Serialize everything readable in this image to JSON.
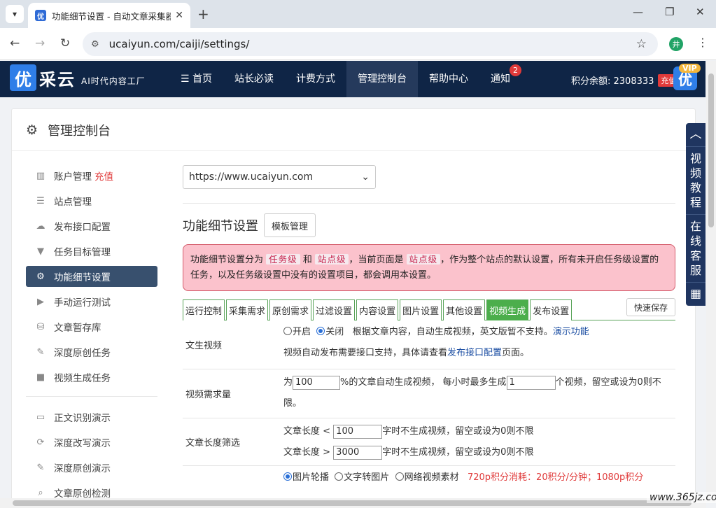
{
  "browser": {
    "tab_title": "功能细节设置 - 自动文章采集器",
    "favicon_text": "优",
    "new_tab_icon": "+",
    "url": "ucaiyun.com/caiji/settings/",
    "profile_initial": "井"
  },
  "site": {
    "logo_badge": "优",
    "logo_text": "采云",
    "slogan": "AI时代内容工厂",
    "nav": [
      {
        "label": "☰ 首页"
      },
      {
        "label": "站长必读"
      },
      {
        "label": "计费方式"
      },
      {
        "label": "管理控制台"
      },
      {
        "label": "帮助中心"
      },
      {
        "label": "通知",
        "badge": "2"
      }
    ],
    "credits_label": "积分余额: 2308333",
    "recharge_label": "充值",
    "vip_label": "VIP",
    "vip_avatar": "优"
  },
  "panel": {
    "title": "管理控制台"
  },
  "sidebar": {
    "items": [
      {
        "label": "账户管理",
        "extra": "充值",
        "icon": "bar-chart-icon"
      },
      {
        "label": "站点管理",
        "icon": "server-icon"
      },
      {
        "label": "发布接口配置",
        "icon": "cloud-upload-icon"
      },
      {
        "label": "任务目标管理",
        "icon": "filter-icon"
      },
      {
        "label": "功能细节设置",
        "icon": "gears-icon"
      },
      {
        "label": "手动运行测试",
        "icon": "play-icon"
      },
      {
        "label": "文章暂存库",
        "icon": "database-icon"
      },
      {
        "label": "深度原创任务",
        "icon": "edit-icon"
      },
      {
        "label": "视频生成任务",
        "icon": "video-icon"
      }
    ],
    "items2": [
      {
        "label": "正文识别演示",
        "icon": "monitor-icon"
      },
      {
        "label": "深度改写演示",
        "icon": "refresh-icon"
      },
      {
        "label": "深度原创演示",
        "icon": "edit-icon"
      },
      {
        "label": "文章原创检测",
        "icon": "search-icon"
      }
    ]
  },
  "content": {
    "site_select_value": "https://www.ucaiyun.com",
    "section_title": "功能细节设置",
    "template_button": "模板管理",
    "alert": {
      "t1": "功能细节设置分为",
      "c1": "任务级",
      "t2": "和",
      "c2": "站点级",
      "t3": "，当前页面是",
      "c3": "站点级",
      "t4": "，作为整个站点的默认设置，所有未开启任务级设置的任务，以及任务级设置中没有的设置项目，都会调用本设置。"
    },
    "tabs": [
      "运行控制",
      "采集需求",
      "原创需求",
      "过滤设置",
      "内容设置",
      "图片设置",
      "其他设置",
      "视频生成",
      "发布设置"
    ],
    "active_tab": "视频生成",
    "quick_save": "快速保存",
    "rows": {
      "text_to_video": {
        "label": "文生视频",
        "opt_on": "开启",
        "opt_off": "关闭",
        "desc": "根据文章内容，自动生成视频，英文版暂不支持。",
        "demo_link": "演示功能",
        "line2_a": "视频自动发布需要接口支持，具体请查看",
        "line2_link": "发布接口配置",
        "line2_b": "页面。"
      },
      "video_demand": {
        "label": "视频需求量",
        "a": "为",
        "pct": "100",
        "b": "%的文章自动生成视频，  每小时最多生成",
        "count": "1",
        "c": "个视频，留空或设为0则不限。"
      },
      "length_filter": {
        "label": "文章长度筛选",
        "min_prefix": "文章长度 <",
        "min_value": "100",
        "min_suffix": "字时不生成视频，留空或设为0则不限",
        "max_prefix": "文章长度 >",
        "max_value": "3000",
        "max_suffix": "字时不生成视频，留空或设为0则不限"
      },
      "source": {
        "opt1": "图片轮播",
        "opt2": "文字转图片",
        "opt3": "网络视频素材",
        "price": "720p积分消耗：20积分/分钟；1080p积分"
      }
    }
  },
  "float_bar": {
    "items": [
      "︿",
      "视频教程",
      "在线客服",
      "▦"
    ]
  },
  "watermark": "www.365jz.com"
}
